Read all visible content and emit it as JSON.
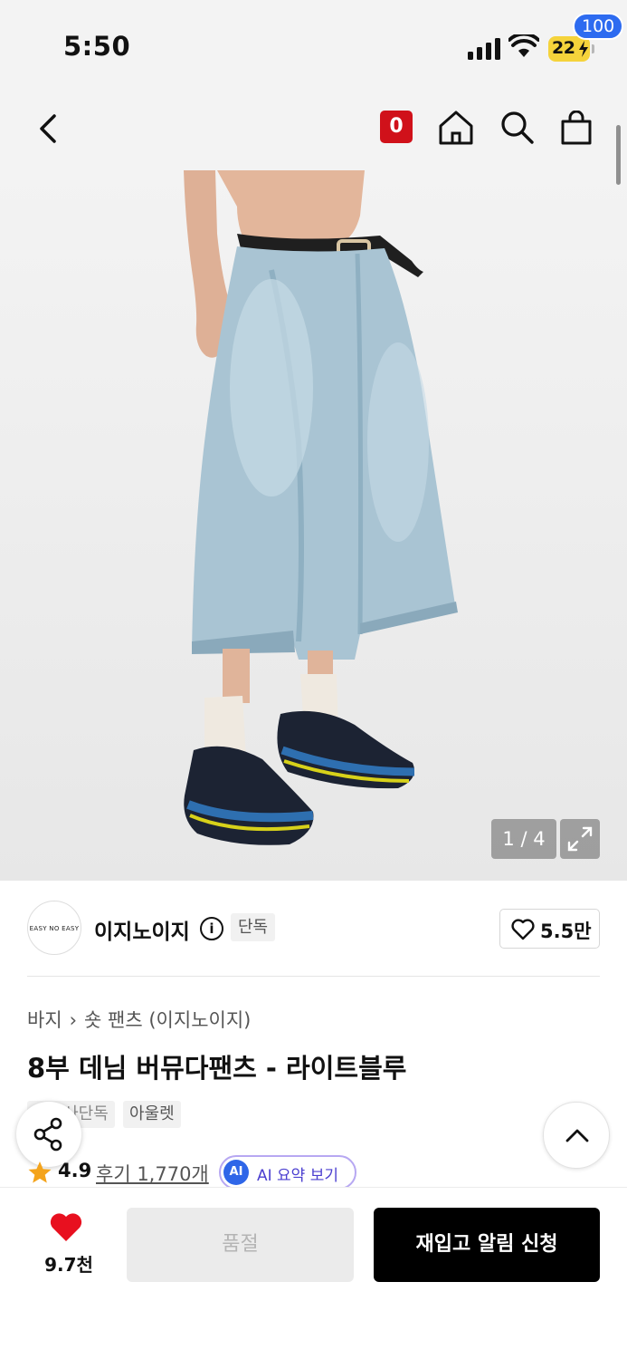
{
  "status_bar": {
    "time": "5:50",
    "battery": "22"
  },
  "header": {
    "back_icon": "chevron-left-icon",
    "zero_badge": "0",
    "home_icon": "home-icon",
    "search_icon": "search-icon",
    "cart_icon": "shopping-bag-icon",
    "cart_count": "100"
  },
  "gallery": {
    "counter": "1 / 4",
    "expand_icon": "expand-icon"
  },
  "brand": {
    "logo_text": "EASY NO EASY",
    "name": "이지노이지",
    "exclusive_tag": "단독",
    "like_count": "5.5만"
  },
  "product": {
    "breadcrumb": [
      "바지",
      "숏 팬츠 (이지노이지)"
    ],
    "title": "8부 데님 버뮤다팬츠 - 라이트블루",
    "tags": [
      "무신사단독",
      "아울렛"
    ],
    "rating": "4.9",
    "reviews": "후기 1,770개",
    "ai_badge": "AI",
    "ai_label": "AI 요약 보기"
  },
  "bottom_bar": {
    "like_count": "9.7천",
    "soldout_label": "품절",
    "restock_label": "재입고 알림 신청"
  },
  "colors": {
    "accent_red": "#d0111a",
    "badge_blue": "#2d6bf0",
    "heart_red": "#e8101f",
    "rating_star": "#f4a41c"
  }
}
